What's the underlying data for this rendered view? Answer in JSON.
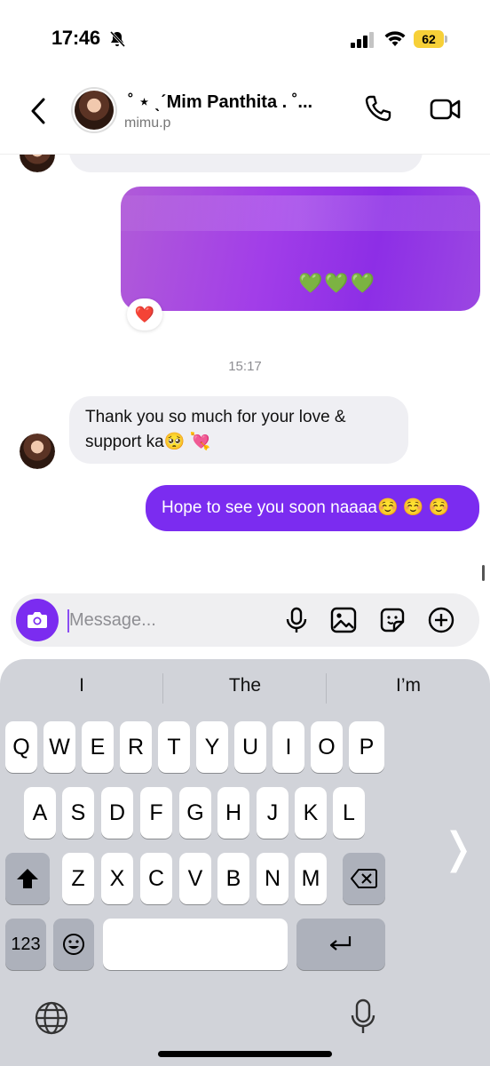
{
  "status_bar": {
    "time": "17:46",
    "battery": "62"
  },
  "header": {
    "name": "˚ ⋆ ˎˊMim Panthita  . ˚...",
    "handle": "mimu.p"
  },
  "chat": {
    "media_hearts": "💚💚💚",
    "media_reaction": "❤️",
    "timestamp": "15:17",
    "incoming_message": "Thank you so much for your love & support ka🥺 💘",
    "outgoing_message": "Hope to see you soon naaaa☺️ ☺️ ☺️"
  },
  "composer": {
    "placeholder": "Message..."
  },
  "keyboard": {
    "suggestions": [
      "I",
      "The",
      "I’m"
    ],
    "row1": [
      "Q",
      "W",
      "E",
      "R",
      "T",
      "Y",
      "U",
      "I",
      "O",
      "P"
    ],
    "row2": [
      "A",
      "S",
      "D",
      "F",
      "G",
      "H",
      "J",
      "K",
      "L"
    ],
    "row3": [
      "Z",
      "X",
      "C",
      "V",
      "B",
      "N",
      "M"
    ],
    "numbers_label": "123"
  },
  "colors": {
    "accent": "#7b2cf0",
    "incoming_bubble": "#efeff3",
    "keyboard_bg": "#d1d3d9",
    "battery": "#f7d038"
  }
}
